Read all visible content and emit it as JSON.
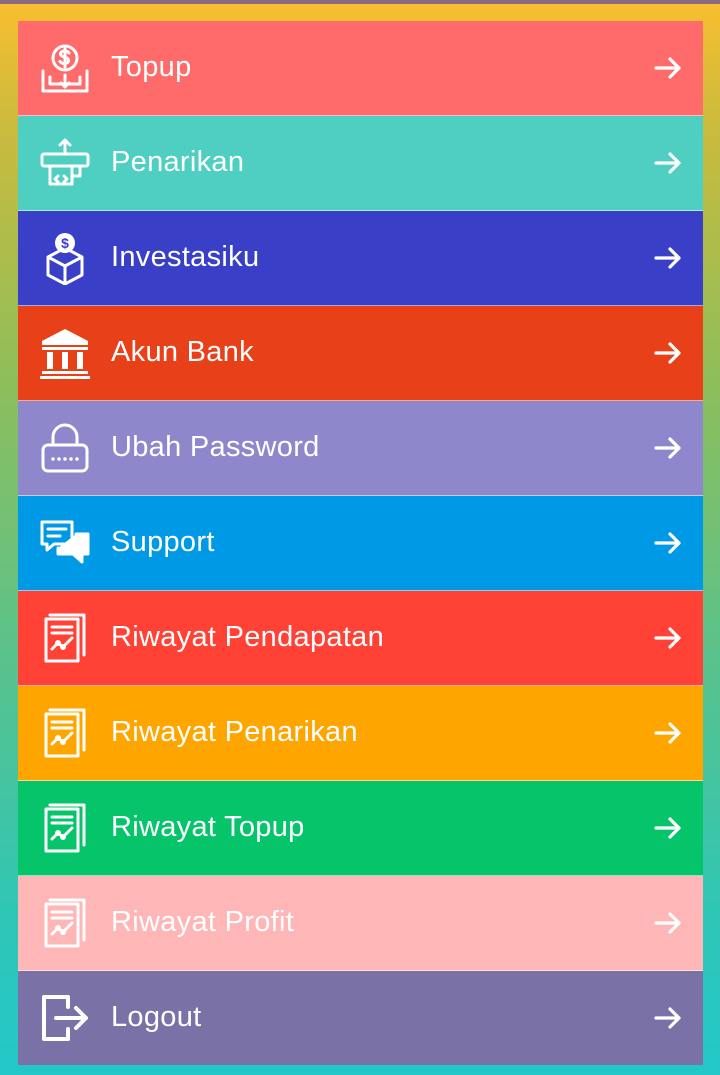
{
  "menu": {
    "items": [
      {
        "label": "Topup",
        "icon": "topup-icon",
        "color": "#ff6b6b"
      },
      {
        "label": "Penarikan",
        "icon": "atm-withdraw-icon",
        "color": "#4ecfc2"
      },
      {
        "label": "Investasiku",
        "icon": "investment-box-icon",
        "color": "#3a3fc8"
      },
      {
        "label": "Akun Bank",
        "icon": "bank-icon",
        "color": "#e8411a"
      },
      {
        "label": "Ubah Password",
        "icon": "lock-icon",
        "color": "#8f87cc"
      },
      {
        "label": "Support",
        "icon": "chat-support-icon",
        "color": "#0099e6"
      },
      {
        "label": "Riwayat Pendapatan",
        "icon": "report-chart-icon",
        "color": "#ff4136"
      },
      {
        "label": "Riwayat Penarikan",
        "icon": "report-chart-icon",
        "color": "#ffa500"
      },
      {
        "label": "Riwayat Topup",
        "icon": "report-chart-icon",
        "color": "#06c46a"
      },
      {
        "label": "Riwayat Profit",
        "icon": "report-chart-icon",
        "color": "#ffb6b6"
      },
      {
        "label": "Logout",
        "icon": "logout-icon",
        "color": "#7a71a6"
      }
    ],
    "arrow_icon": "arrow-right-icon"
  }
}
